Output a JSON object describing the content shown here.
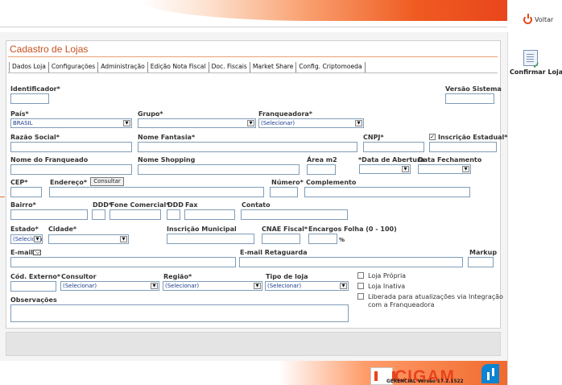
{
  "header": {
    "back_label": "Voltar"
  },
  "sidebar": {
    "confirm_label": "Confirmar Loja"
  },
  "page": {
    "title": "Cadastro de Lojas"
  },
  "tabs": [
    "Dados Loja",
    "Configurações",
    "Administração",
    "Edição Nota Fiscal",
    "Doc. Fiscais",
    "Market Share",
    "Config. Criptomoeda"
  ],
  "form": {
    "identificador": {
      "label": "Identificador*",
      "value": ""
    },
    "versao_sistema": {
      "label": "Versão Sistema",
      "value": ""
    },
    "pais": {
      "label": "País*",
      "value": "BRASIL"
    },
    "grupo": {
      "label": "Grupo*",
      "value": ""
    },
    "franqueadora": {
      "label": "Franqueadora*",
      "value": "(Selecionar)"
    },
    "razao_social": {
      "label": "Razão Social*",
      "value": ""
    },
    "nome_fantasia": {
      "label": "Nome Fantasia*",
      "value": ""
    },
    "cnpj": {
      "label": "CNPJ*",
      "value": ""
    },
    "inscricao_estadual": {
      "label": "Inscrição Estadual*",
      "checked": true,
      "value": ""
    },
    "nome_franqueado": {
      "label": "Nome do Franqueado",
      "value": ""
    },
    "nome_shopping": {
      "label": "Nome Shopping",
      "value": ""
    },
    "area_m2": {
      "label": "Área m2",
      "value": ""
    },
    "data_abertura": {
      "label": "*Data de Abertura",
      "value": ""
    },
    "data_fechamento": {
      "label": "Data Fechamento",
      "value": ""
    },
    "cep": {
      "label": "CEP*",
      "value": ""
    },
    "endereco": {
      "label": "Endereço*",
      "value": ""
    },
    "consultar": {
      "label": "Consultar"
    },
    "numero": {
      "label": "Número*",
      "value": ""
    },
    "complemento": {
      "label": "Complemento",
      "value": ""
    },
    "bairro": {
      "label": "Bairro*",
      "value": ""
    },
    "ddd": {
      "label": "DDD*",
      "value": ""
    },
    "fone_comercial": {
      "label": "Fone Comercial*",
      "value": ""
    },
    "ddd_fax": {
      "label": "DDD",
      "value": ""
    },
    "fax": {
      "label": "Fax",
      "value": ""
    },
    "contato": {
      "label": "Contato",
      "value": ""
    },
    "estado": {
      "label": "Estado*",
      "value": "(Selecionar)"
    },
    "cidade": {
      "label": "Cidade*",
      "value": ""
    },
    "inscricao_municipal": {
      "label": "Inscrição Municipal",
      "value": ""
    },
    "cnae_fiscal": {
      "label": "CNAE Fiscal*",
      "value": ""
    },
    "encargos_folha": {
      "label": "Encargos Folha (0 - 100)",
      "value": "",
      "unit": "%"
    },
    "email": {
      "label": "E-mail",
      "value": ""
    },
    "email_retaguarda": {
      "label": "E-mail Retaguarda",
      "value": ""
    },
    "markup": {
      "label": "Markup",
      "value": ""
    },
    "cod_externo": {
      "label": "Cód. Externo*",
      "value": ""
    },
    "consultor": {
      "label": "Consultor",
      "value": "(Selecionar)"
    },
    "regiao": {
      "label": "Região*",
      "value": "(Selecionar)"
    },
    "tipo_loja": {
      "label": "Tipo de loja",
      "value": "(Selecionar)"
    },
    "loja_propria": {
      "label": "Loja Própria",
      "checked": false
    },
    "loja_inativa": {
      "label": "Loja Inativa",
      "checked": false
    },
    "liberada": {
      "label": "Liberada para atualizações via Integração com a Franqueadora",
      "line1": "Liberada para atualizações via Integração",
      "line2": "com a Franqueadora",
      "checked": false
    },
    "observacoes": {
      "label": "Observações",
      "value": ""
    }
  },
  "logo": {
    "name": "CIGAM",
    "subtitle": "GERENCIAL  Versão 17.2.1522"
  },
  "icons": {
    "back": "power-icon",
    "confirm": "document-check-icon",
    "email": "envelope-icon",
    "dropdown": "chevron-down-icon"
  }
}
